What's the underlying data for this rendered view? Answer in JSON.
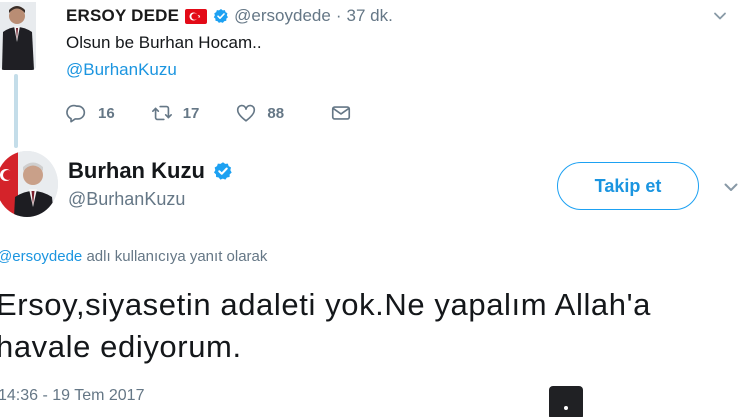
{
  "colors": {
    "link": "#1b95e0",
    "muted": "#657786",
    "verified": "#1da1f2",
    "flag_red": "#e30a17",
    "thread_line": "#c4dde9"
  },
  "parent_tweet": {
    "name": "ERSOY DEDE",
    "flag_icon": "turkey-flag-icon",
    "handle": "@ersoydede",
    "separator": "·",
    "time": "37 dk.",
    "text": "Olsun be Burhan Hocam..",
    "mention": "@BurhanKuzu",
    "actions": {
      "reply_count": "16",
      "retweet_count": "17",
      "like_count": "88"
    }
  },
  "main_tweet": {
    "name": "Burhan Kuzu",
    "handle": "@BurhanKuzu",
    "follow_label": "Takip et",
    "reply_to_handle": "@ersoydede",
    "reply_to_suffix": " adlı kullanıcıya yanıt olarak",
    "text": "Ersoy,siyasetin adaleti yok.Ne yapalım Allah'a\nhavale ediyorum.",
    "timestamp": "14:36 - 19 Tem 2017"
  }
}
